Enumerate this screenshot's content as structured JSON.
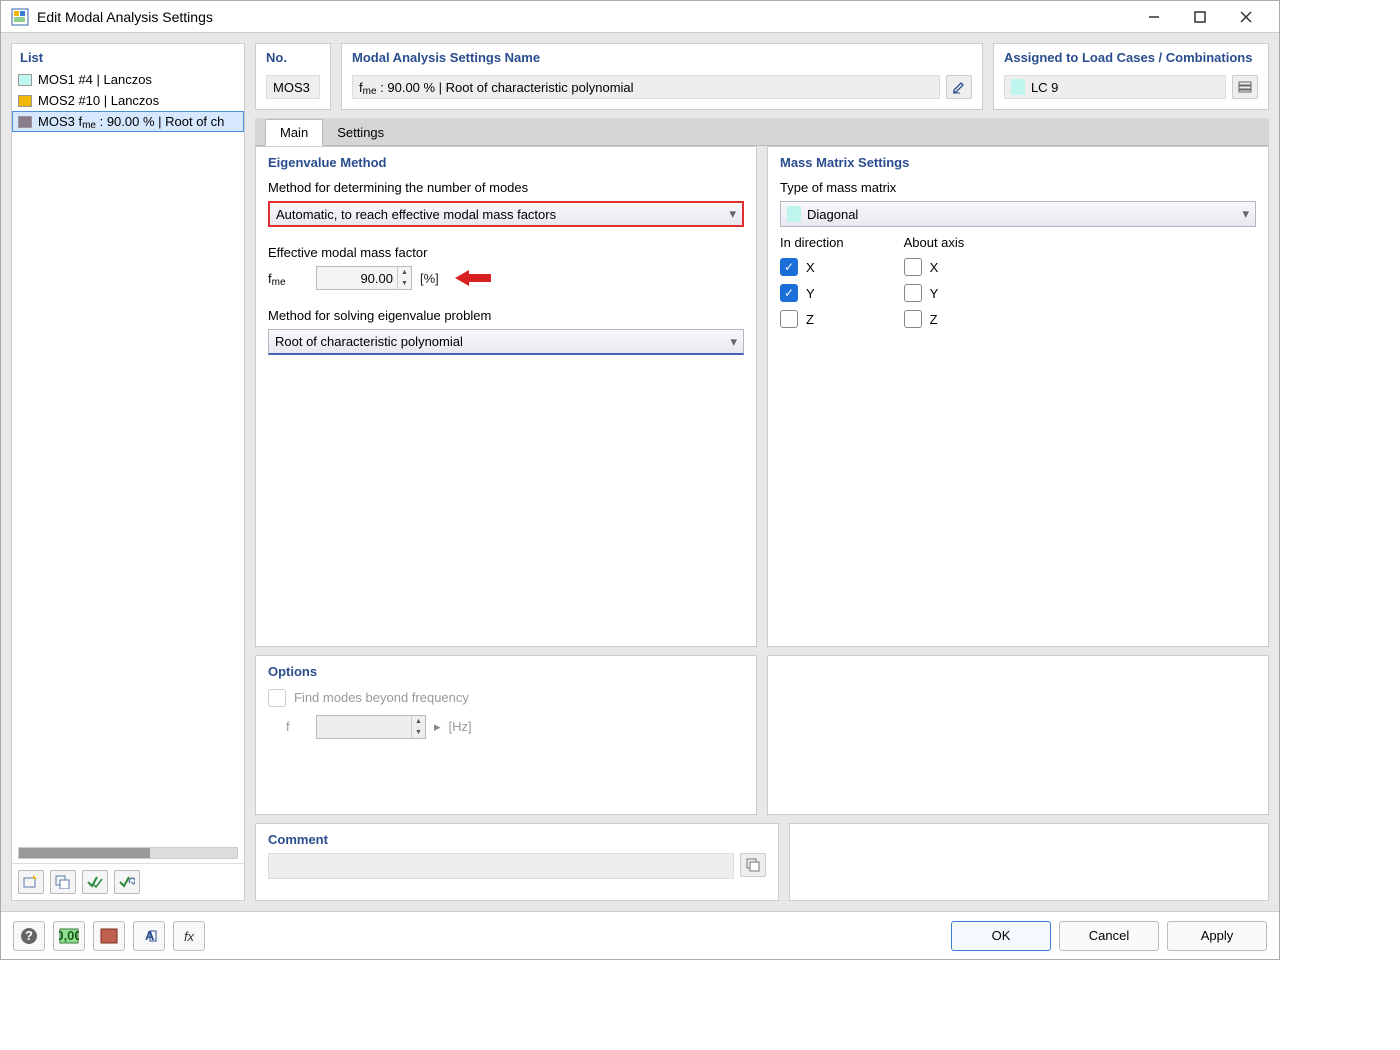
{
  "window": {
    "title": "Edit Modal Analysis Settings"
  },
  "list": {
    "title": "List",
    "items": [
      {
        "id": "MOS1",
        "label": "MOS1 #4 | Lanczos",
        "color": "#bff5ef"
      },
      {
        "id": "MOS2",
        "label": "MOS2 #10 | Lanczos",
        "color": "#f2b705"
      },
      {
        "id": "MOS3",
        "label_prefix": "MOS3 f",
        "label_sub": "me",
        "label_suffix": " : 90.00 % | Root of ch",
        "color": "#8a7a8a",
        "selected": true
      }
    ]
  },
  "header": {
    "no_label": "No.",
    "no_value": "MOS3",
    "name_label": "Modal Analysis Settings Name",
    "name_value_prefix": "f",
    "name_value_sub": "me",
    "name_value_suffix": " : 90.00 % | Root of characteristic polynomial",
    "assigned_label": "Assigned to Load Cases / Combinations",
    "assigned_value": "LC 9"
  },
  "tabs": {
    "main": "Main",
    "settings": "Settings"
  },
  "eigen": {
    "title": "Eigenvalue Method",
    "modes_label": "Method for determining the number of modes",
    "modes_value": "Automatic, to reach effective modal mass factors",
    "factor_label": "Effective modal mass factor",
    "factor_symbol_pre": "f",
    "factor_symbol_sub": "me",
    "factor_value": "90.00",
    "factor_unit": "[%]",
    "solver_label": "Method for solving eigenvalue problem",
    "solver_value": "Root of characteristic polynomial"
  },
  "mass": {
    "title": "Mass Matrix Settings",
    "type_label": "Type of mass matrix",
    "type_value": "Diagonal",
    "dir_label": "In direction",
    "axis_label": "About axis",
    "x": "X",
    "y": "Y",
    "z": "Z"
  },
  "options": {
    "title": "Options",
    "find_label": "Find modes beyond frequency",
    "f_label": "f",
    "f_unit": "[Hz]"
  },
  "comment": {
    "title": "Comment"
  },
  "footer": {
    "ok": "OK",
    "cancel": "Cancel",
    "apply": "Apply"
  },
  "colors": {
    "assigned_swatch": "#bff5ef",
    "mass_swatch": "#bff5ef"
  }
}
